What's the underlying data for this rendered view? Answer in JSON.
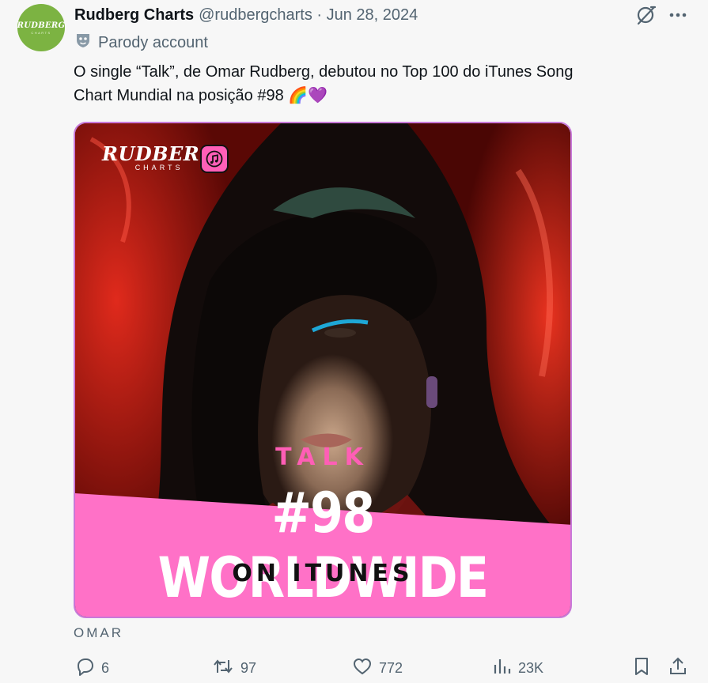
{
  "account": {
    "avatar_line1": "RUDBERG",
    "avatar_line2": "CHARTS",
    "display_name": "Rudberg Charts",
    "meta": "@rudbergcharts · Jun 28, 2024",
    "parody_label": "Parody account"
  },
  "tweet": {
    "line1": "O single “Talk”, de Omar Rudberg, debutou no Top 100 do iTunes Song",
    "line2": "Chart Mundial na posição #98 🌈💜"
  },
  "media": {
    "logo_line1": "RUDBERG",
    "logo_line2": "CHARTS",
    "song": "TALK",
    "rank_text": "#98 WORLDWIDE",
    "platform_text": "ON ITUNES",
    "accent_pink": "#ff5eb6",
    "band_pink": "#ff71c7"
  },
  "caption": "OMAR",
  "actions": {
    "replies": "6",
    "reposts": "97",
    "likes": "772",
    "views": "23K"
  },
  "icons": [
    "grok-icon",
    "more-icon",
    "parody-mask-icon",
    "apple-music-icon",
    "reply-icon",
    "repost-icon",
    "like-icon",
    "views-icon",
    "bookmark-icon",
    "share-icon"
  ]
}
